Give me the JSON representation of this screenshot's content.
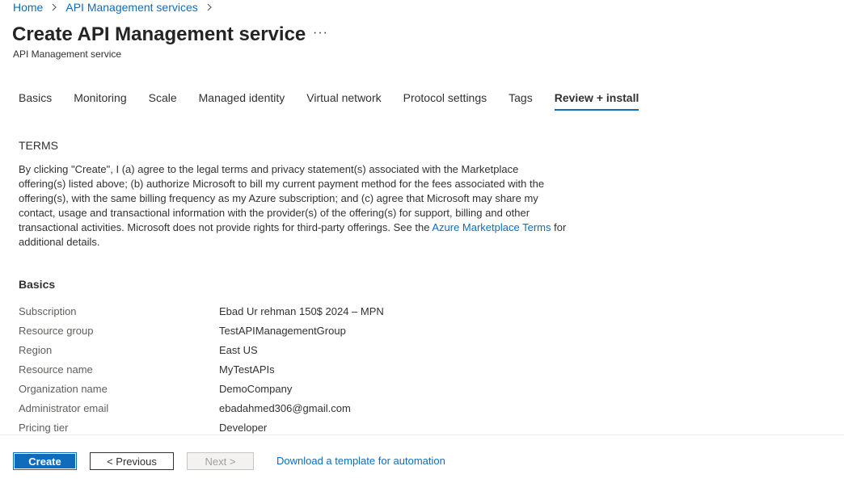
{
  "breadcrumb": {
    "items": [
      "Home",
      "API Management services"
    ]
  },
  "header": {
    "title": "Create API Management service",
    "more_label": "···",
    "subtitle": "API Management service"
  },
  "tabs": [
    {
      "label": "Basics",
      "active": false
    },
    {
      "label": "Monitoring",
      "active": false
    },
    {
      "label": "Scale",
      "active": false
    },
    {
      "label": "Managed identity",
      "active": false
    },
    {
      "label": "Virtual network",
      "active": false
    },
    {
      "label": "Protocol settings",
      "active": false
    },
    {
      "label": "Tags",
      "active": false
    },
    {
      "label": "Review + install",
      "active": true
    }
  ],
  "terms": {
    "heading": "TERMS",
    "text_before_link": "By clicking \"Create\", I (a) agree to the legal terms and privacy statement(s) associated with the Marketplace offering(s) listed above; (b) authorize Microsoft to bill my current payment method for the fees associated with the offering(s), with the same billing frequency as my Azure subscription; and (c) agree that Microsoft may share my contact, usage and transactional information with the provider(s) of the offering(s) for support, billing and other transactional activities. Microsoft does not provide rights for third-party offerings. See the ",
    "link_text": "Azure Marketplace Terms",
    "text_after_link": " for additional details."
  },
  "basics": {
    "heading": "Basics",
    "rows": [
      {
        "label": "Subscription",
        "value": "Ebad Ur rehman 150$ 2024 – MPN"
      },
      {
        "label": "Resource group",
        "value": "TestAPIManagementGroup"
      },
      {
        "label": "Region",
        "value": "East US"
      },
      {
        "label": "Resource name",
        "value": "MyTestAPIs"
      },
      {
        "label": "Organization name",
        "value": "DemoCompany"
      },
      {
        "label": "Administrator email",
        "value": "ebadahmed306@gmail.com"
      },
      {
        "label": "Pricing tier",
        "value": "Developer"
      }
    ]
  },
  "footer": {
    "create_label": "Create",
    "previous_label": "< Previous",
    "next_label": "Next >",
    "automation_link": "Download a template for automation"
  },
  "colors": {
    "accent": "#0f6cbd",
    "text": "#323130",
    "label": "#605e5c"
  }
}
